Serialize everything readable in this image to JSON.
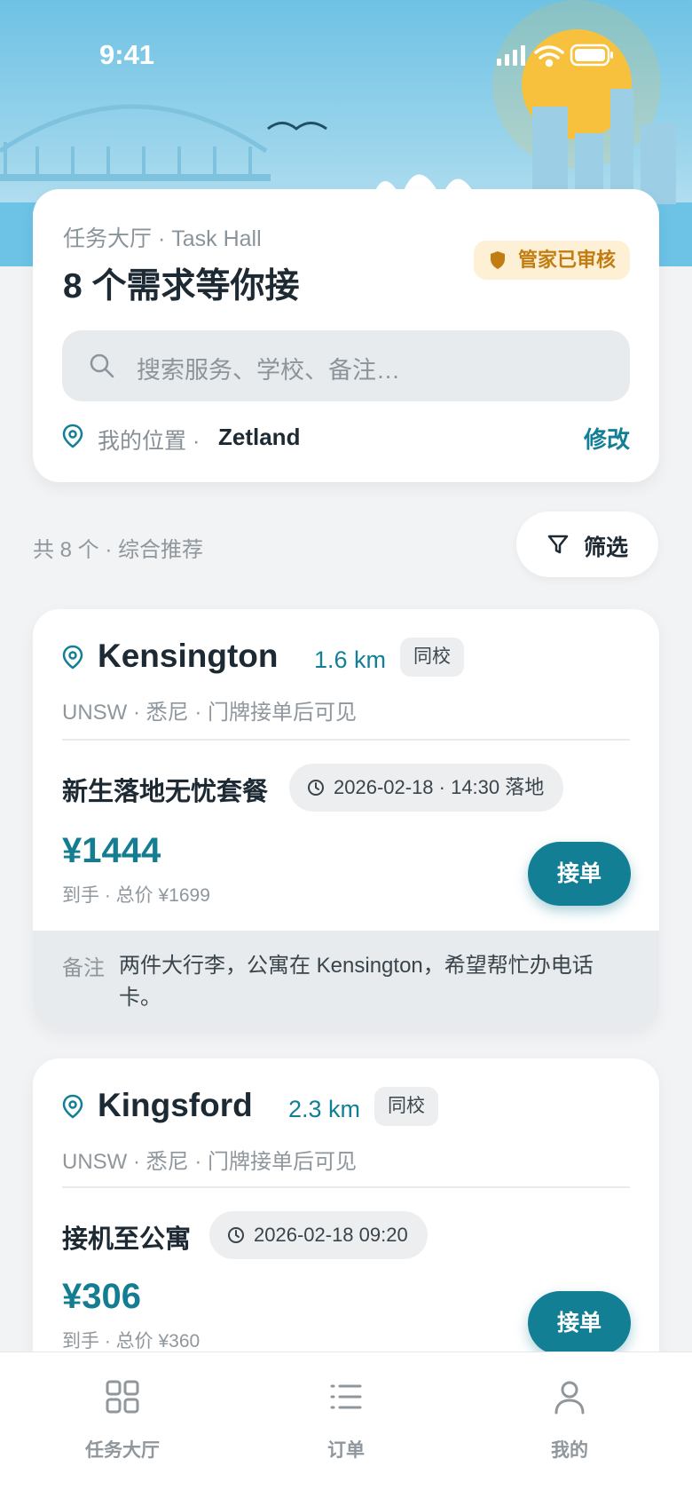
{
  "status_bar": {
    "time": "9:41"
  },
  "header": {
    "subtitle": "任务大厅 · Task Hall",
    "title": "8 个需求等你接",
    "badge": "管家已审核",
    "search_placeholder": "搜索服务、学校、备注…",
    "location_label": "我的位置 ·",
    "location_value": "Zetland",
    "location_edit": "修改"
  },
  "list_summary": {
    "text": "共 8 个 · 综合推荐",
    "filter_label": "筛选"
  },
  "tasks": [
    {
      "area": "Kensington",
      "distance": "1.6 km",
      "tag": "同校",
      "meta": "UNSW · 悉尼 · 门牌接单后可见",
      "service": "新生落地无忧套餐",
      "time": "2026-02-18 · 14:30 落地",
      "price": "¥1444",
      "price_note": "到手 · 总价 ¥1699",
      "accept": "接单",
      "note_label": "备注",
      "note": "两件大行李，公寓在 Kensington，希望帮忙办电话卡。"
    },
    {
      "area": "Kingsford",
      "distance": "2.3 km",
      "tag": "同校",
      "meta": "UNSW · 悉尼 · 门牌接单后可见",
      "service": "接机至公寓",
      "time": "2026-02-18 09:20",
      "price": "¥306",
      "price_note": "到手 · 总价 ¥360",
      "accept": "接单"
    }
  ],
  "tabbar": {
    "items": [
      {
        "label": "任务大厅",
        "icon": "grid-icon"
      },
      {
        "label": "订单",
        "icon": "list-icon"
      },
      {
        "label": "我的",
        "icon": "user-icon"
      }
    ]
  },
  "colors": {
    "accent": "#137f94",
    "badge_bg": "#fdf0d5",
    "badge_text": "#c27d12",
    "page_bg": "#f2f3f5"
  }
}
